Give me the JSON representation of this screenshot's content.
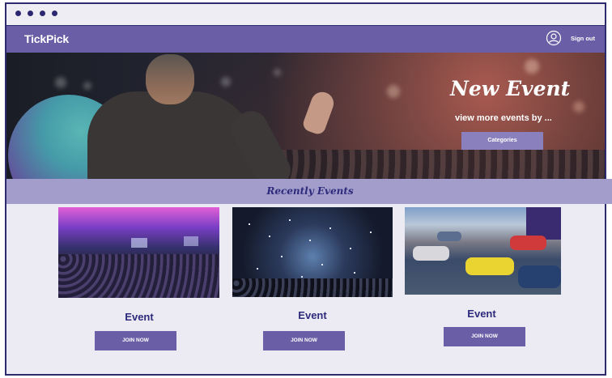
{
  "window": {
    "chrome_dots": 4
  },
  "navbar": {
    "logo": "TickPick",
    "signout": "Sign out"
  },
  "hero": {
    "title": "New Event",
    "subtitle": "view more events by  ...",
    "button": "Categories"
  },
  "section": {
    "title": "Recently Events"
  },
  "events": [
    {
      "title": "Event",
      "button": "JOIN NOW"
    },
    {
      "title": "Event",
      "button": "JOIN NOW"
    },
    {
      "title": "Event",
      "button": "JOIN NOW"
    }
  ],
  "colors": {
    "navbar": "#6a5fa6",
    "section_bar": "#a39dcb",
    "accent_text": "#2d2a7c",
    "page_bg": "#ecebf3"
  }
}
